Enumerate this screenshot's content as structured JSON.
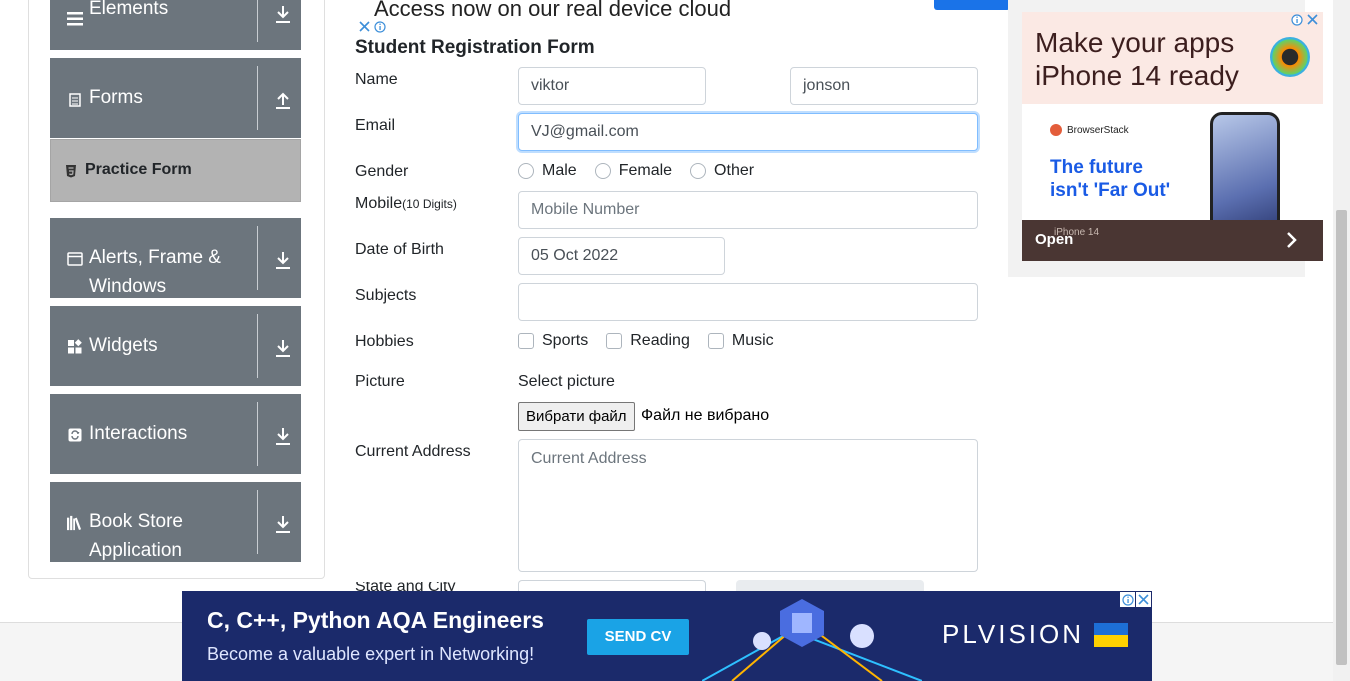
{
  "top_ad": {
    "headline": "Access now on our real device cloud"
  },
  "sidebar": {
    "groups": [
      {
        "label": "Elements",
        "icon": "hamburger-icon",
        "toggle": "download-arrow-icon"
      },
      {
        "label": "Forms",
        "icon": "document-icon",
        "toggle": "upload-arrow-icon"
      },
      {
        "label": "Alerts, Frame & Windows",
        "icon": "window-icon",
        "toggle": "download-arrow-icon"
      },
      {
        "label": "Widgets",
        "icon": "widgets-icon",
        "toggle": "download-arrow-icon"
      },
      {
        "label": "Interactions",
        "icon": "refresh-icon",
        "toggle": "download-arrow-icon"
      },
      {
        "label": "Book Store Application",
        "icon": "books-icon",
        "toggle": "download-arrow-icon"
      }
    ],
    "active_item": {
      "label": "Practice Form",
      "icon": "html5-icon"
    }
  },
  "form": {
    "title": "Student Registration Form",
    "name": {
      "label": "Name",
      "first_value": "viktor",
      "last_value": "jonson"
    },
    "email": {
      "label": "Email",
      "value": "VJ@gmail.com"
    },
    "gender": {
      "label": "Gender",
      "options": [
        "Male",
        "Female",
        "Other"
      ]
    },
    "mobile": {
      "label": "Mobile",
      "hint": "(10 Digits)",
      "placeholder": "Mobile Number"
    },
    "dob": {
      "label": "Date of Birth",
      "value": "05 Oct 2022"
    },
    "subjects": {
      "label": "Subjects"
    },
    "hobbies": {
      "label": "Hobbies",
      "options": [
        "Sports",
        "Reading",
        "Music"
      ]
    },
    "picture": {
      "label": "Picture",
      "select_text": "Select picture",
      "button": "Вибрати файл",
      "status": "Файл не вибрано"
    },
    "address": {
      "label": "Current Address",
      "placeholder": "Current Address"
    }
  },
  "right_ad": {
    "headline_1": "Make your apps",
    "headline_2": "iPhone 14 ready",
    "brand": "BrowserStack",
    "tagline_1": "The future",
    "tagline_2": "isn't 'Far Out'",
    "cta": "Open",
    "model": "iPhone 14"
  },
  "bottom_ad": {
    "title": "C, C++, Python AQA Engineers",
    "subtitle": "Become a valuable expert in Networking!",
    "cta": "SEND CV",
    "brand": "PLVISION"
  },
  "colors": {
    "sidebar_bg": "#6c757d",
    "active_item_bg": "#b3b3b3",
    "focus_border": "#80bdff",
    "bottom_ad_bg": "#1b2a6b",
    "bottom_ad_cta": "#1aa3e6"
  }
}
